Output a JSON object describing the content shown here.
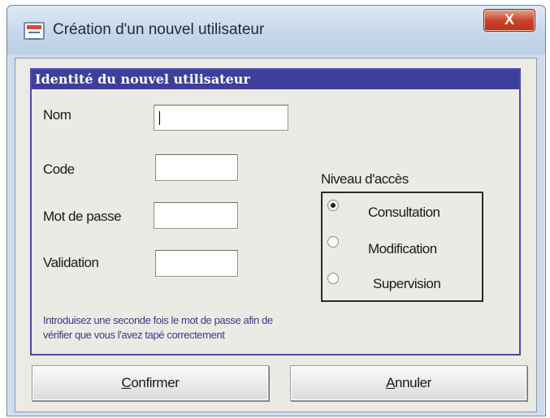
{
  "window": {
    "title": "Création d'un nouvel utilisateur",
    "close_label": "X"
  },
  "group": {
    "header": "Identité du nouvel utilisateur"
  },
  "fields": {
    "nom": {
      "label": "Nom",
      "value": ""
    },
    "code": {
      "label": "Code",
      "value": ""
    },
    "mot_de_passe": {
      "label": "Mot de passe",
      "value": ""
    },
    "validation": {
      "label": "Validation",
      "value": ""
    }
  },
  "hint": "Introduisez une seconde fois le mot de passe afin de vérifier que vous l'avez tapé correctement",
  "access": {
    "title": "Niveau d'accès",
    "options": [
      {
        "label": "Consultation",
        "checked": true
      },
      {
        "label": "Modification",
        "checked": false
      },
      {
        "label": "Supervision",
        "checked": false
      }
    ]
  },
  "buttons": {
    "confirm": {
      "mnemonic": "C",
      "rest": "onfirmer"
    },
    "cancel": {
      "mnemonic": "A",
      "rest": "nnuler"
    }
  },
  "colors": {
    "group_header": "#3d3f9a",
    "close_button": "#c8452d"
  }
}
